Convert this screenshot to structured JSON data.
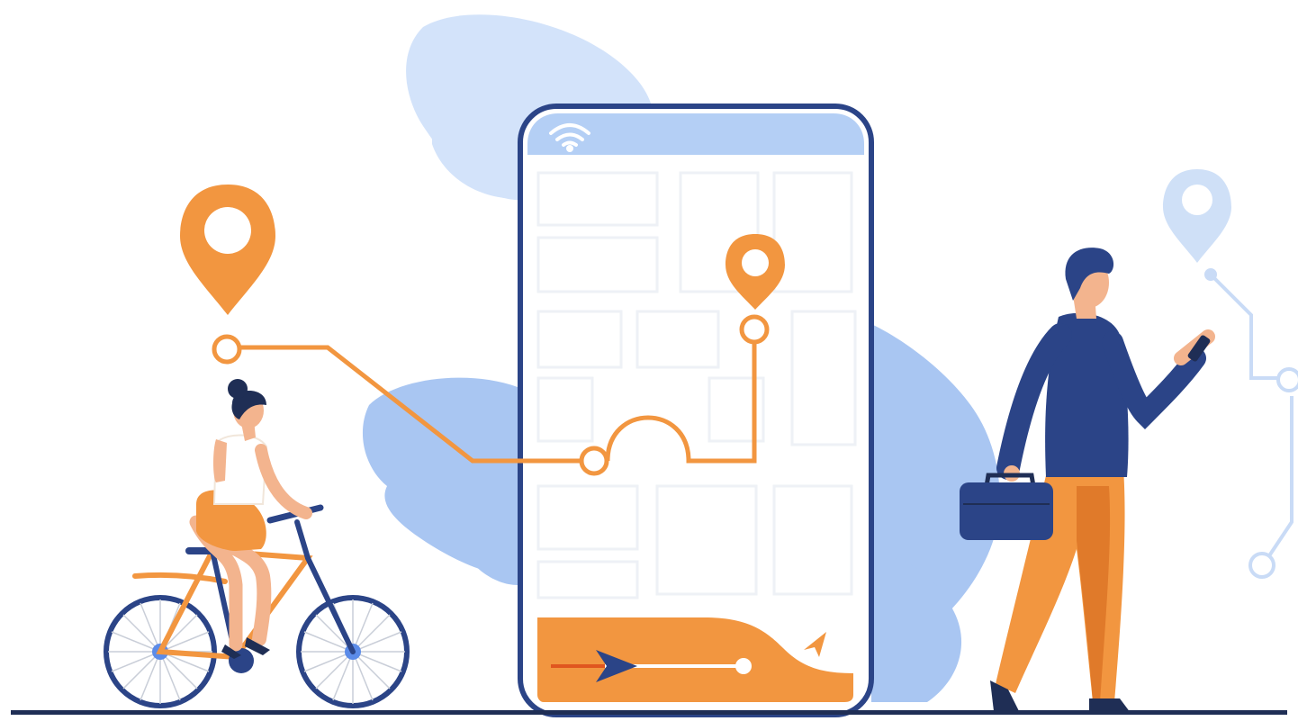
{
  "illustration": {
    "icons": [
      "wifi-icon",
      "location-pin-icon",
      "navigation-arrow-icon",
      "play-icon"
    ],
    "colors": {
      "orange": "#F29640",
      "dark_orange": "#E07A2A",
      "navy": "#2B4487",
      "dark_navy": "#1F2E55",
      "leaf_blue": "#A9C6F2",
      "light_blue": "#D3E3FA",
      "screen_top": "#B4CFF5",
      "skin": "#F3B48E",
      "hair": "#1F2E55"
    },
    "route_progress": 0.8
  }
}
